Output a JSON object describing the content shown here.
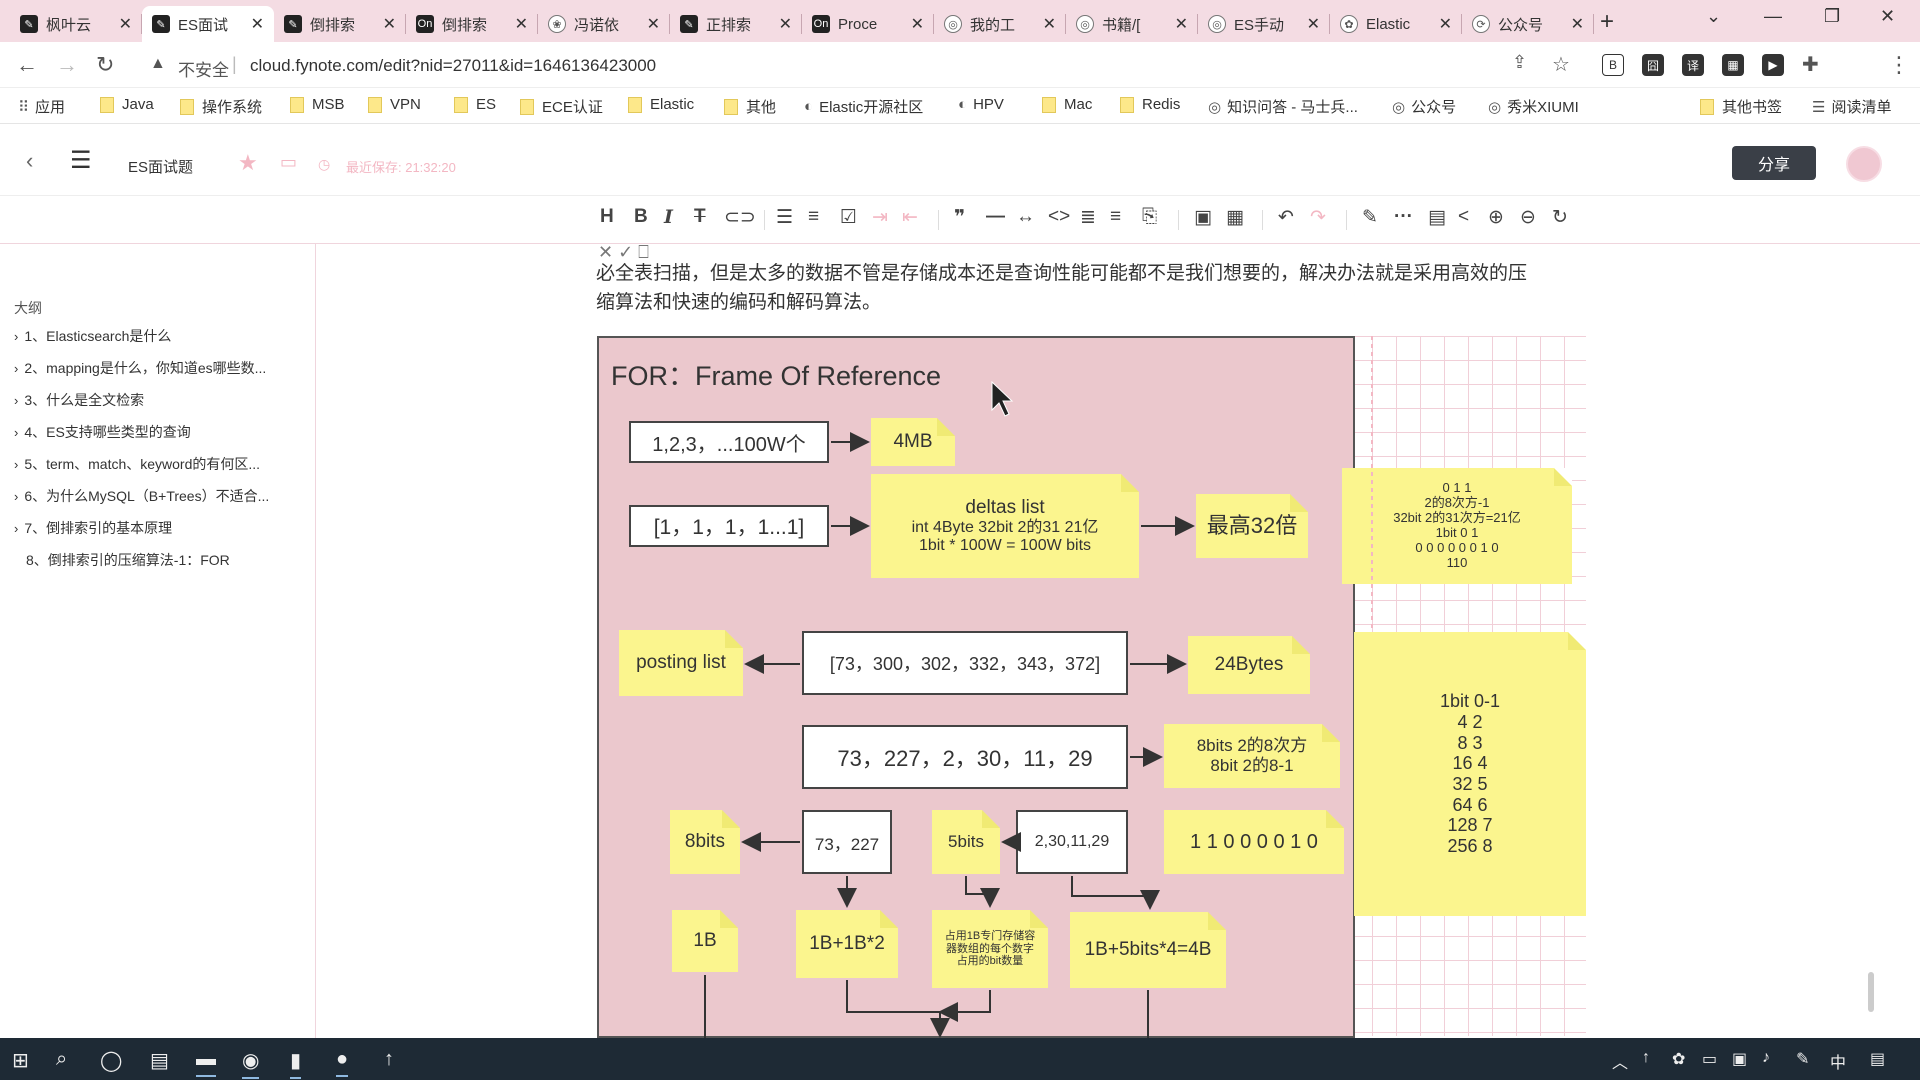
{
  "tabs": [
    {
      "icon": "fynote",
      "title": "枫叶云",
      "active": false
    },
    {
      "icon": "fynote",
      "title": "ES面试",
      "active": true
    },
    {
      "icon": "fynote",
      "title": "倒排索",
      "active": false
    },
    {
      "icon": "on",
      "title": "倒排索",
      "active": false
    },
    {
      "icon": "paw",
      "title": "冯诺依",
      "active": false
    },
    {
      "icon": "fynote",
      "title": "正排索",
      "active": false
    },
    {
      "icon": "on",
      "title": "Proce",
      "active": false
    },
    {
      "icon": "spiral",
      "title": "我的工",
      "active": false
    },
    {
      "icon": "spiral",
      "title": "书籍/[",
      "active": false
    },
    {
      "icon": "es",
      "title": "ES手动",
      "active": false
    },
    {
      "icon": "elastic",
      "title": "Elastic",
      "active": false
    },
    {
      "icon": "sync",
      "title": "公众号",
      "active": false
    }
  ],
  "address": {
    "insecure_label": "不安全",
    "url": "cloud.fynote.com/edit?nid=27011&id=1646136423000"
  },
  "bookmarks": [
    {
      "type": "apps",
      "label": "应用"
    },
    {
      "type": "folder",
      "label": "Java"
    },
    {
      "type": "folder",
      "label": "操作系统"
    },
    {
      "type": "folder",
      "label": "MSB"
    },
    {
      "type": "folder",
      "label": "VPN"
    },
    {
      "type": "folder",
      "label": "ES"
    },
    {
      "type": "folder",
      "label": "ECE认证"
    },
    {
      "type": "folder",
      "label": "Elastic"
    },
    {
      "type": "folder",
      "label": "其他"
    },
    {
      "type": "globe",
      "label": "Elastic开源社区"
    },
    {
      "type": "globe",
      "label": "HPV"
    },
    {
      "type": "folder",
      "label": "Mac"
    },
    {
      "type": "folder",
      "label": "Redis"
    },
    {
      "type": "site",
      "label": "知识问答 - 马士兵..."
    },
    {
      "type": "site",
      "label": "公众号"
    },
    {
      "type": "site",
      "label": "秀米XIUMI"
    }
  ],
  "bookmarks_right": {
    "other": "其他书签",
    "reading": "阅读清单"
  },
  "app": {
    "doc_title": "ES面试题",
    "save_status": "最近保存: 21:32:20",
    "share_label": "分享"
  },
  "outline": {
    "heading": "大纲",
    "items": [
      "1、Elasticsearch是什么",
      "2、mapping是什么，你知道es哪些数...",
      "3、什么是全文检索",
      "4、ES支持哪些类型的查询",
      "5、term、match、keyword的有何区...",
      "6、为什么MySQL（B+Trees）不适合...",
      "7、倒排索引的基本原理",
      "8、倒排索引的压缩算法-1：FOR"
    ]
  },
  "paragraph": {
    "line1": "必全表扫描，但是太多的数据不管是存储成本还是查询性能可能都不是我们想要的，解决办法就是采用高效的压",
    "line2": "缩算法和快速的编码和解码算法。"
  },
  "diagram": {
    "title": "FOR：Frame Of Reference",
    "box_range": "1,2,3，...100W个",
    "note_4mb": "4MB",
    "box_ones": "[1，1，1，1...1]",
    "deltas": {
      "title": "deltas list",
      "line1": "int 4Byte 32bit  2的31 21亿",
      "line2": "1bit * 100W = 100W bits"
    },
    "note_32x": "最高32倍",
    "side_note1": [
      "0 1 1",
      "2的8次方-1",
      "32bit 2的31次方=21亿",
      "1bit 0 1",
      "0 0 0 0 0 0 1 0",
      "110"
    ],
    "note_posting": "posting list",
    "box_posting": "[73，300，302，332，343，372]",
    "note_24bytes": "24Bytes",
    "box_deltas": "73，227，2，30，11，29",
    "note_8bits_pow": {
      "line1": "8bits 2的8次方",
      "line2": "8bit  2的8-1"
    },
    "note_8bits": "8bits",
    "box_73_227": "73，227",
    "note_5bits": "5bits",
    "box_small": "2,30,11,29",
    "note_binary": "1 1 0 0 0 0 1 0",
    "side_note2": [
      "1bit  0-1",
      "4 2",
      "8  3",
      "16 4",
      "32 5",
      "64 6",
      "128 7",
      "256 8"
    ],
    "note_1b": "1B",
    "note_1b_1b2": "1B+1B*2",
    "note_header_desc": "占用1B专门存储容\n器数组的每个数字\n占用的bit数量",
    "note_1b_5bits": "1B+5bits*4=4B"
  },
  "colors": {
    "tab_strip": "#f4dce3",
    "board": "#ebc8cd",
    "sticky": "#fbf58e",
    "taskbar": "#1e2a35",
    "share_btn": "#3a3f47"
  },
  "taskbar": {
    "ime": "中"
  }
}
